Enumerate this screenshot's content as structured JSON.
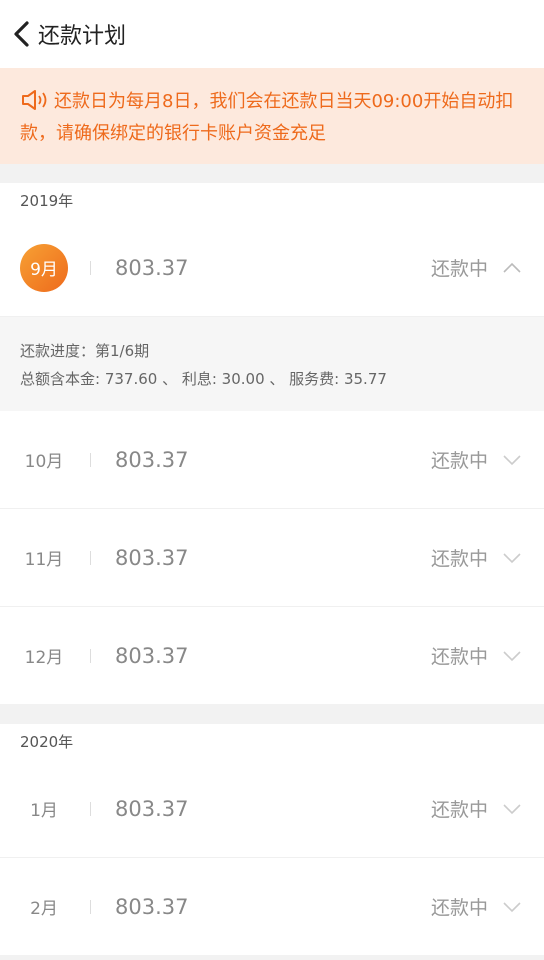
{
  "header": {
    "title": "还款计划"
  },
  "notice": {
    "text": "还款日为每月8日，我们会在还款日当天09:00开始自动扣款，请确保绑定的银行卡账户资金充足"
  },
  "years": [
    {
      "label": "2019年",
      "rows": [
        {
          "month": "9月",
          "amount": "803.37",
          "status": "还款中",
          "expanded": true
        },
        {
          "month": "10月",
          "amount": "803.37",
          "status": "还款中"
        },
        {
          "month": "11月",
          "amount": "803.37",
          "status": "还款中"
        },
        {
          "month": "12月",
          "amount": "803.37",
          "status": "还款中"
        }
      ],
      "detail": {
        "progress": "还款进度：第1/6期",
        "breakdown": "总额含本金: 737.60 、 利息: 30.00 、 服务费: 35.77"
      }
    },
    {
      "label": "2020年",
      "rows": [
        {
          "month": "1月",
          "amount": "803.37",
          "status": "还款中"
        },
        {
          "month": "2月",
          "amount": "803.37",
          "status": "还款中"
        }
      ]
    }
  ],
  "colors": {
    "accent": "#ee6a1c",
    "notice_bg": "#fde9dd"
  },
  "icons": {
    "back": "chevron-left-icon",
    "speaker": "speaker-icon",
    "expand": "chevron-down-icon",
    "collapse": "chevron-up-icon"
  }
}
